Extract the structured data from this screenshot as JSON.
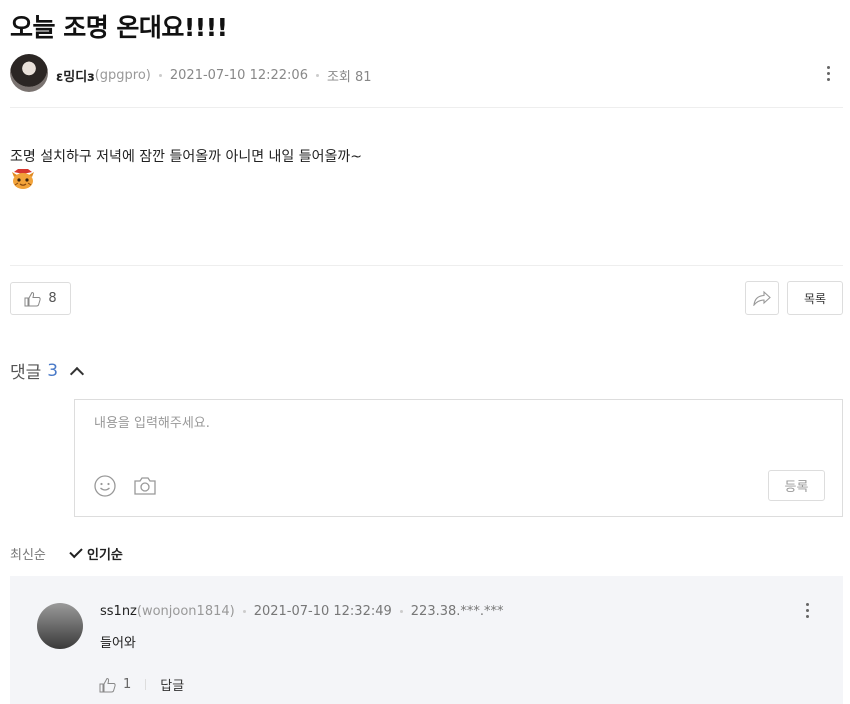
{
  "post": {
    "title": "오늘 조명 온대요!!!!",
    "author_nick": "ε밍디з",
    "author_id": "(gpgpro)",
    "date": "2021-07-10 12:22:06",
    "views_label": "조회 81",
    "body": "조명 설치하구 저녁에 잠깐 들어올까 아니면 내일 들어올까~",
    "likes": "8",
    "list_label": "목록"
  },
  "comments_section": {
    "label": "댓글",
    "count": "3",
    "placeholder": "내용을 입력해주세요.",
    "submit_label": "등록",
    "sort_latest": "최신순",
    "sort_popular": "인기순"
  },
  "comments": [
    {
      "nick": "ss1nz",
      "user_id": "(wonjoon1814)",
      "date": "2021-07-10 12:32:49",
      "ip": "223.38.***.***",
      "text": "들어와",
      "likes": "1",
      "reply_label": "답글"
    }
  ],
  "colors": {
    "accent": "#4a7ac8",
    "comment_bg": "#f4f5f8"
  }
}
